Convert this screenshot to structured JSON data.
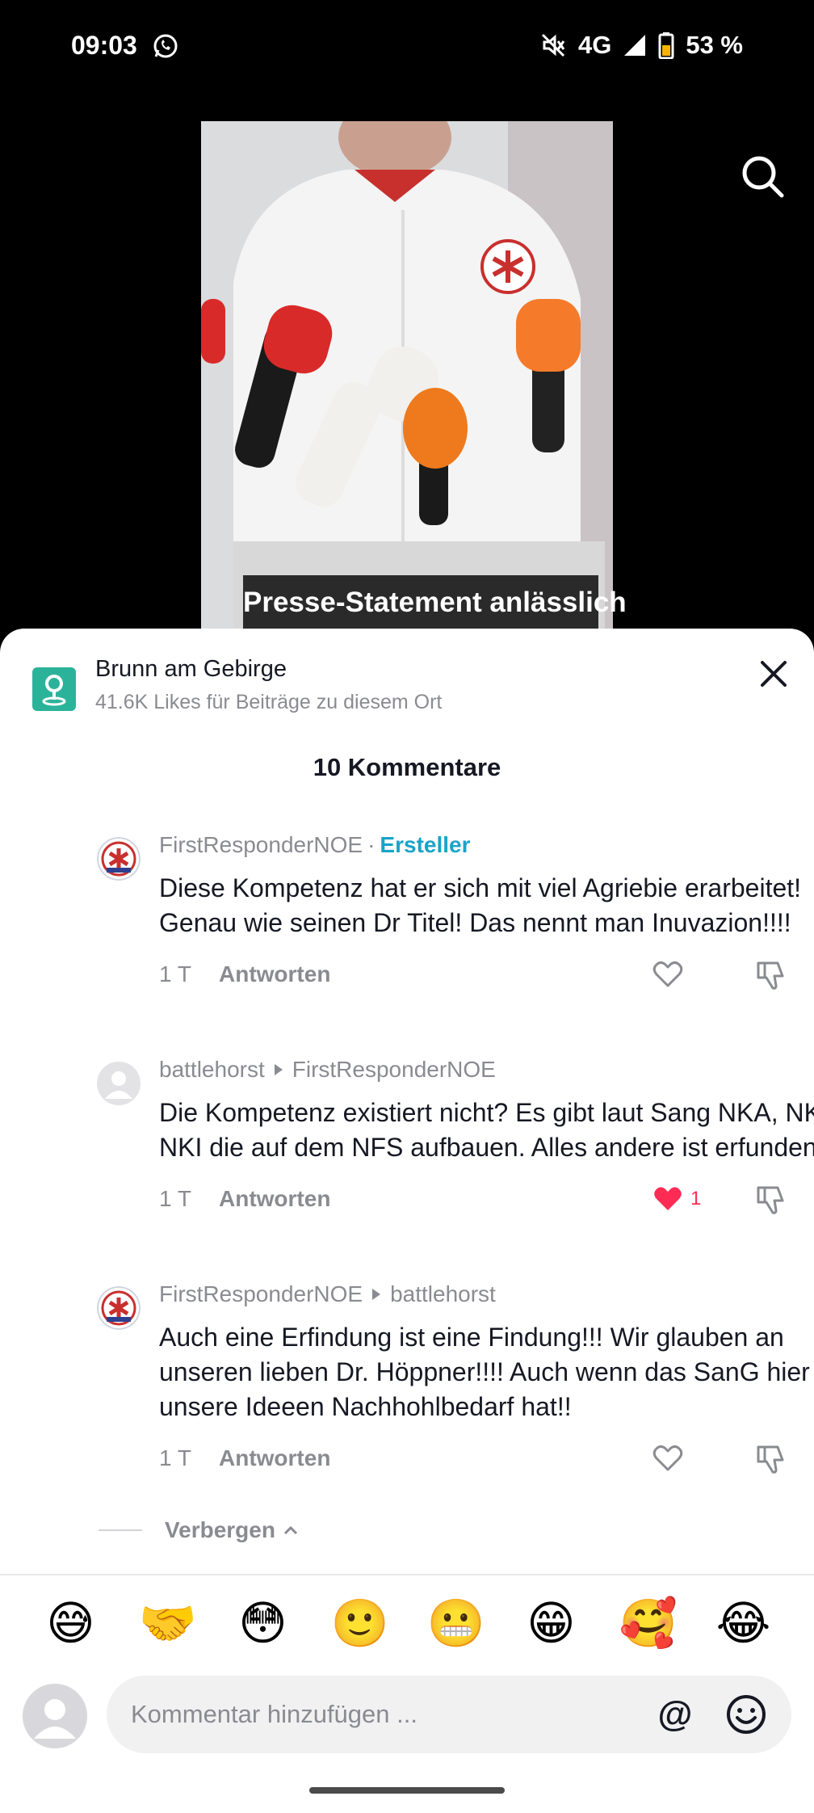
{
  "status_bar": {
    "time": "09:03",
    "network": "4G",
    "battery": "53 %",
    "icons": [
      "whatsapp-icon",
      "mute-icon",
      "signal-icon",
      "battery-icon"
    ]
  },
  "video": {
    "caption": "Presse-Statement anlässlich",
    "search_icon": "search-icon"
  },
  "location": {
    "title": "Brunn am Gebirge",
    "subtitle": "41.6K Likes für Beiträge zu diesem Ort"
  },
  "comments_title": "10 Kommentare",
  "comments": [
    {
      "author": "FirstResponderNOE",
      "separator": "·",
      "badge": "Ersteller",
      "reply_to": "",
      "text": "Diese Kompetenz hat er sich mit viel Agriebie erarbeitet! Genau wie seinen Dr Titel! Das nennt man Inuvazion!!!!",
      "time": "1 T",
      "reply_label": "Antworten",
      "likes": "",
      "liked": false
    },
    {
      "author": "battlehorst",
      "separator": "",
      "badge": "",
      "reply_to": "FirstResponderNOE",
      "text": "Die Kompetenz existiert nicht? Es gibt laut Sang NKA, NKV, NKI die auf dem NFS aufbauen. Alles andere ist erfunden",
      "time": "1 T",
      "reply_label": "Antworten",
      "likes": "1",
      "liked": true
    },
    {
      "author": "FirstResponderNOE",
      "separator": "",
      "badge": "",
      "reply_to": "battlehorst",
      "text": "Auch eine Erfindung ist eine Findung!!! Wir glauben an unseren lieben Dr. Höppner!!!! Auch wenn das SanG hier für unsere Ideeen Nachhohlbedarf hat!!",
      "time": "1 T",
      "reply_label": "Antworten",
      "likes": "",
      "liked": false
    }
  ],
  "hide_label": "Verbergen",
  "quick_emojis": [
    "😅",
    "🤝",
    "😳",
    "🙂",
    "😬",
    "😁",
    "🥰",
    "😂"
  ],
  "input": {
    "placeholder": "Kommentar hinzufügen ...",
    "at_symbol": "@"
  },
  "colors": {
    "accent_creator": "#1aa3c9",
    "like_red": "#fe2c55",
    "place_green": "#2bb39a"
  }
}
